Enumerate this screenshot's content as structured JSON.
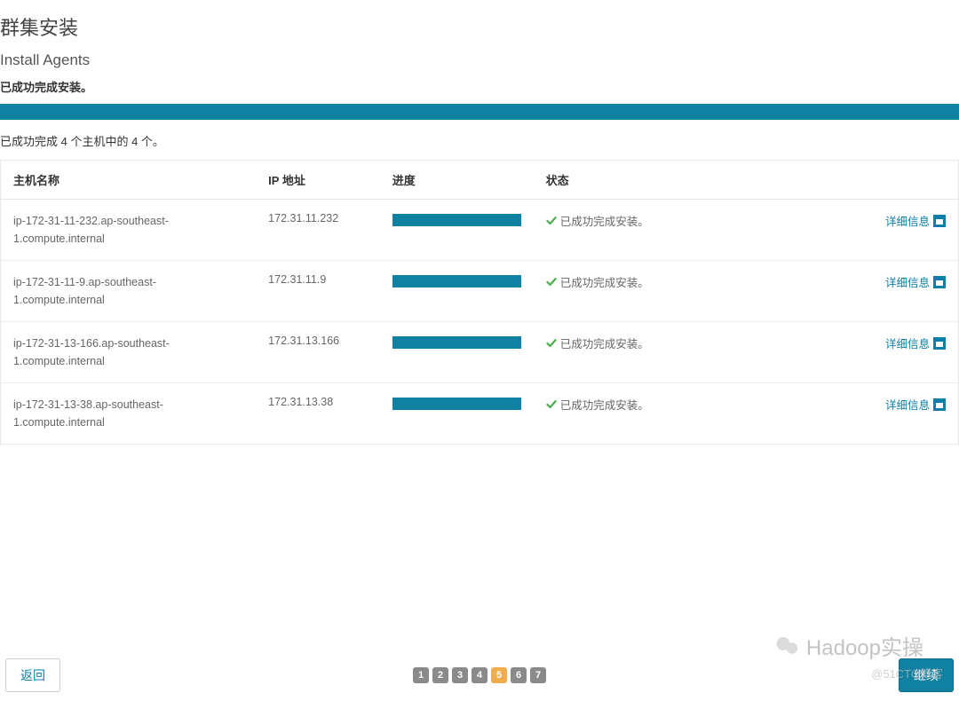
{
  "header": {
    "title": "群集安装",
    "subtitle": "Install Agents",
    "success_msg": "已成功完成安装。",
    "summary": "已成功完成 4 个主机中的 4 个。"
  },
  "table": {
    "columns": {
      "host": "主机名称",
      "ip": "IP 地址",
      "progress": "进度",
      "status": "状态"
    },
    "rows": [
      {
        "host": "ip-172-31-11-232.ap-southeast-1.compute.internal",
        "ip": "172.31.11.232",
        "status": "已成功完成安装。",
        "detail": "详细信息"
      },
      {
        "host": "ip-172-31-11-9.ap-southeast-1.compute.internal",
        "ip": "172.31.11.9",
        "status": "已成功完成安装。",
        "detail": "详细信息"
      },
      {
        "host": "ip-172-31-13-166.ap-southeast-1.compute.internal",
        "ip": "172.31.13.166",
        "status": "已成功完成安装。",
        "detail": "详细信息"
      },
      {
        "host": "ip-172-31-13-38.ap-southeast-1.compute.internal",
        "ip": "172.31.13.38",
        "status": "已成功完成安装。",
        "detail": "详细信息"
      }
    ]
  },
  "pagination": {
    "pages": [
      "1",
      "2",
      "3",
      "4",
      "5",
      "6",
      "7"
    ],
    "active": "5"
  },
  "footer": {
    "back": "返回",
    "continue": "继续"
  },
  "watermark": {
    "line1": "Hadoop实操",
    "line2": "@51CTO博客"
  }
}
